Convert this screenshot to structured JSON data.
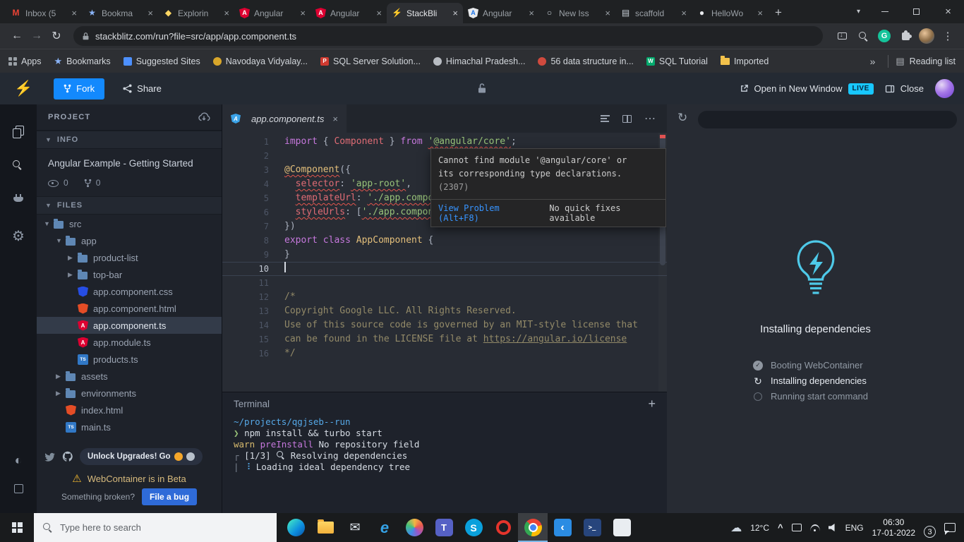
{
  "browser": {
    "tabs": [
      {
        "label": "Inbox (5",
        "icon": "gmail",
        "active": false
      },
      {
        "label": "Bookma",
        "icon": "star",
        "active": false
      },
      {
        "label": "Explorin",
        "icon": "spark",
        "active": false
      },
      {
        "label": "Angular",
        "icon": "angular",
        "active": false
      },
      {
        "label": "Angular",
        "icon": "angular",
        "active": false
      },
      {
        "label": "StackBli",
        "icon": "stackblitz",
        "active": true
      },
      {
        "label": "Angular",
        "icon": "angular-light",
        "active": false
      },
      {
        "label": "New Iss",
        "icon": "issue",
        "active": false
      },
      {
        "label": "scaffold",
        "icon": "doc",
        "active": false
      },
      {
        "label": "HelloWo",
        "icon": "github",
        "active": false
      }
    ],
    "address": "stackblitz.com/run?file=src/app/app.component.ts",
    "bookmarks": [
      {
        "label": "Apps",
        "icon": "grid",
        "color": "#9aa0a6"
      },
      {
        "label": "Bookmarks",
        "icon": "star",
        "color": "#8ab4f8"
      },
      {
        "label": "Suggested Sites",
        "icon": "square",
        "color": "#4d90fe"
      },
      {
        "label": "Navodaya Vidyalay...",
        "icon": "circle",
        "color": "#d8a62a"
      },
      {
        "label": "SQL Server Solution...",
        "icon": "square",
        "color": "#cf3a30",
        "char": "PSD"
      },
      {
        "label": "Himachal Pradesh...",
        "icon": "circle",
        "color": "#b8bcc2"
      },
      {
        "label": "56 data structure in...",
        "icon": "circle",
        "color": "#d04a3e"
      },
      {
        "label": "SQL Tutorial",
        "icon": "square",
        "color": "#04aa6d",
        "char": "W"
      },
      {
        "label": "Imported",
        "icon": "folder",
        "color": "#f2c14b"
      }
    ],
    "more_bookmarks": "»",
    "reading_list": "Reading list"
  },
  "sb": {
    "fork": "Fork",
    "share": "Share",
    "open_window": "Open in New Window",
    "live": "LIVE",
    "close": "Close",
    "explorer": {
      "project": "PROJECT",
      "info": "INFO",
      "project_name": "Angular Example - Getting Started",
      "views": "0",
      "forks": "0",
      "files": "FILES",
      "tree": [
        {
          "name": "src",
          "type": "folder",
          "level": 0,
          "open": true
        },
        {
          "name": "app",
          "type": "folder",
          "level": 1,
          "open": true
        },
        {
          "name": "product-list",
          "type": "folder",
          "level": 2
        },
        {
          "name": "top-bar",
          "type": "folder",
          "level": 2
        },
        {
          "name": "app.component.css",
          "type": "css",
          "level": 2
        },
        {
          "name": "app.component.html",
          "type": "html",
          "level": 2
        },
        {
          "name": "app.component.ts",
          "type": "angular",
          "level": 2,
          "selected": true
        },
        {
          "name": "app.module.ts",
          "type": "angular",
          "level": 2
        },
        {
          "name": "products.ts",
          "type": "ts",
          "level": 2
        },
        {
          "name": "assets",
          "type": "folder",
          "level": 1
        },
        {
          "name": "environments",
          "type": "folder",
          "level": 1
        },
        {
          "name": "index.html",
          "type": "html",
          "level": 1
        },
        {
          "name": "main.ts",
          "type": "ts",
          "level": 1
        }
      ],
      "upgrade": "Unlock Upgrades! Go",
      "beta": "WebContainer is in Beta",
      "broken": "Something broken?",
      "file_bug": "File a bug"
    },
    "editor": {
      "tab": "app.component.ts",
      "lines": [
        {
          "n": 1,
          "segs": [
            [
              "kw",
              "import"
            ],
            [
              "pl",
              " { "
            ],
            [
              "red",
              "Component"
            ],
            [
              "pl",
              " } "
            ],
            [
              "kw",
              "from"
            ],
            [
              "pl",
              " "
            ],
            [
              "str err",
              "'@angular/core'"
            ],
            [
              "pl",
              ";"
            ]
          ]
        },
        {
          "n": 2,
          "segs": []
        },
        {
          "n": 3,
          "segs": [
            [
              "yel err",
              "@Component"
            ],
            [
              "pl",
              "({"
            ]
          ]
        },
        {
          "n": 4,
          "segs": [
            [
              "pl",
              "  "
            ],
            [
              "red err",
              "selector"
            ],
            [
              "pl",
              ": "
            ],
            [
              "str err",
              "'app-root'"
            ],
            [
              "pl",
              ","
            ]
          ]
        },
        {
          "n": 5,
          "segs": [
            [
              "pl",
              "  "
            ],
            [
              "red err",
              "templateUrl"
            ],
            [
              "pl",
              ": "
            ],
            [
              "str err",
              "'./app.component.html'"
            ],
            [
              "pl",
              ","
            ]
          ]
        },
        {
          "n": 6,
          "segs": [
            [
              "pl",
              "  "
            ],
            [
              "red err",
              "styleUrls"
            ],
            [
              "pl",
              ": ["
            ],
            [
              "str err",
              "'./app.component.css'"
            ],
            [
              "pl",
              "]"
            ]
          ]
        },
        {
          "n": 7,
          "segs": [
            [
              "pl",
              "})"
            ]
          ]
        },
        {
          "n": 8,
          "segs": [
            [
              "kw",
              "export"
            ],
            [
              "pl",
              " "
            ],
            [
              "kw",
              "class"
            ],
            [
              "pl",
              " "
            ],
            [
              "yel",
              "AppComponent"
            ],
            [
              "pl",
              " {"
            ]
          ]
        },
        {
          "n": 9,
          "segs": [
            [
              "pl",
              "}"
            ]
          ]
        },
        {
          "n": 10,
          "segs": [],
          "active": true,
          "cursor": true
        },
        {
          "n": 11,
          "segs": []
        },
        {
          "n": 12,
          "segs": [
            [
              "cm",
              "/*"
            ]
          ]
        },
        {
          "n": 13,
          "segs": [
            [
              "cm",
              "Copyright Google LLC. All Rights Reserved."
            ]
          ]
        },
        {
          "n": 14,
          "segs": [
            [
              "cm",
              "Use of this source code is governed by an MIT-style license that"
            ]
          ]
        },
        {
          "n": 15,
          "segs": [
            [
              "cm",
              "can be found in the LICENSE file at "
            ],
            [
              "cm lnk",
              "https://angular.io/license"
            ]
          ]
        },
        {
          "n": 16,
          "segs": [
            [
              "cm",
              "*/"
            ]
          ]
        }
      ],
      "hover": {
        "line1": "Cannot find module '@angular/core' or",
        "line2": "its corresponding type declarations.",
        "line3": "(2307)",
        "action": "View Problem (Alt+F8)",
        "no_fix": "No quick fixes available"
      }
    },
    "terminal": {
      "title": "Terminal",
      "lines": [
        [
          [
            "cy",
            "~/projects/qgjseb--run"
          ]
        ],
        [
          [
            "gr",
            "❯ "
          ],
          [
            "pl",
            "npm install && turbo start"
          ]
        ],
        [
          [
            "yw",
            "warn "
          ],
          [
            "mg",
            "preInstall "
          ],
          [
            "pl",
            "No repository field"
          ]
        ],
        [
          [
            "dm",
            "┌ "
          ],
          [
            "pl",
            "[1/3] "
          ],
          [
            "icomag",
            "🔍"
          ],
          [
            "pl",
            " Resolving dependencies"
          ]
        ],
        [
          [
            "dm",
            "| "
          ],
          [
            "cy",
            "⠸ "
          ],
          [
            "pl",
            "Loading ideal dependency tree"
          ]
        ]
      ]
    },
    "preview": {
      "heading": "Installing dependencies",
      "steps": [
        {
          "label": "Booting WebContainer",
          "state": "done"
        },
        {
          "label": "Installing dependencies",
          "state": "active"
        },
        {
          "label": "Running start command",
          "state": "pending"
        }
      ]
    }
  },
  "taskbar": {
    "search": "Type here to search",
    "apps": [
      {
        "name": "edge",
        "active": false
      },
      {
        "name": "file-explorer",
        "active": false
      },
      {
        "name": "mail",
        "active": false
      },
      {
        "name": "edge-legacy",
        "active": false
      },
      {
        "name": "photos",
        "active": false
      },
      {
        "name": "teams",
        "active": false
      },
      {
        "name": "skype",
        "active": false
      },
      {
        "name": "opera",
        "active": false
      },
      {
        "name": "chrome",
        "active": true
      },
      {
        "name": "vscode",
        "active": false
      },
      {
        "name": "powershell",
        "active": false
      },
      {
        "name": "paint",
        "active": false
      }
    ],
    "tray": {
      "temperature": "12°C",
      "language": "ENG",
      "time": "06:30",
      "date": "17-01-2022",
      "notifications": "3"
    }
  }
}
